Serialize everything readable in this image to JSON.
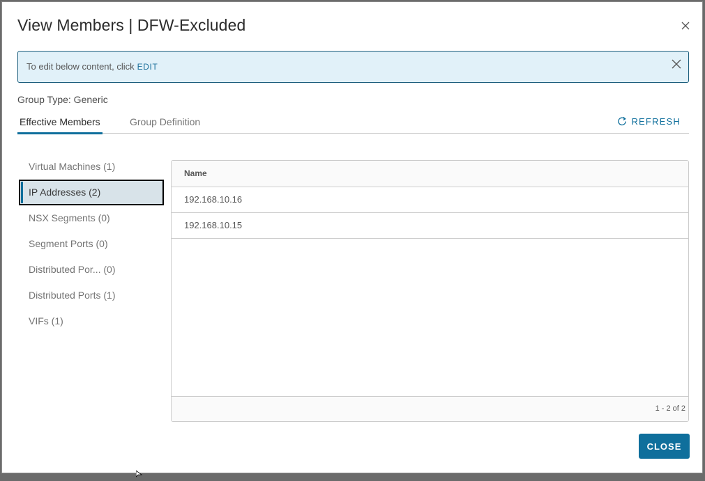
{
  "dialog": {
    "title": "View Members | DFW-Excluded",
    "close_icon": "close-icon"
  },
  "alert": {
    "text": "To edit below content, click",
    "edit_link": "EDIT",
    "dismiss_icon": "close-icon"
  },
  "group_type": "Group Type: Generic",
  "tabs": [
    {
      "label": "Effective Members",
      "active": true
    },
    {
      "label": "Group Definition",
      "active": false
    }
  ],
  "refresh": {
    "label": "REFRESH",
    "icon": "refresh-icon"
  },
  "sidebar": {
    "items": [
      {
        "label": "Virtual Machines (1)",
        "active": false
      },
      {
        "label": "IP Addresses (2)",
        "active": true
      },
      {
        "label": "NSX Segments (0)",
        "active": false
      },
      {
        "label": "Segment Ports (0)",
        "active": false
      },
      {
        "label": "Distributed Por...  (0)",
        "active": false
      },
      {
        "label": "Distributed Ports (1)",
        "active": false
      },
      {
        "label": "VIFs (1)",
        "active": false
      }
    ]
  },
  "grid": {
    "columns": [
      "Name"
    ],
    "rows": [
      [
        "192.168.10.16"
      ],
      [
        "192.168.10.15"
      ]
    ],
    "footer": "1 - 2 of 2"
  },
  "footer": {
    "close_label": "CLOSE"
  },
  "colors": {
    "accent": "#0f6f9c",
    "alert_bg": "#e1f1f9",
    "alert_border": "#1c5e7d",
    "selected_bg": "#d8e3e9"
  }
}
